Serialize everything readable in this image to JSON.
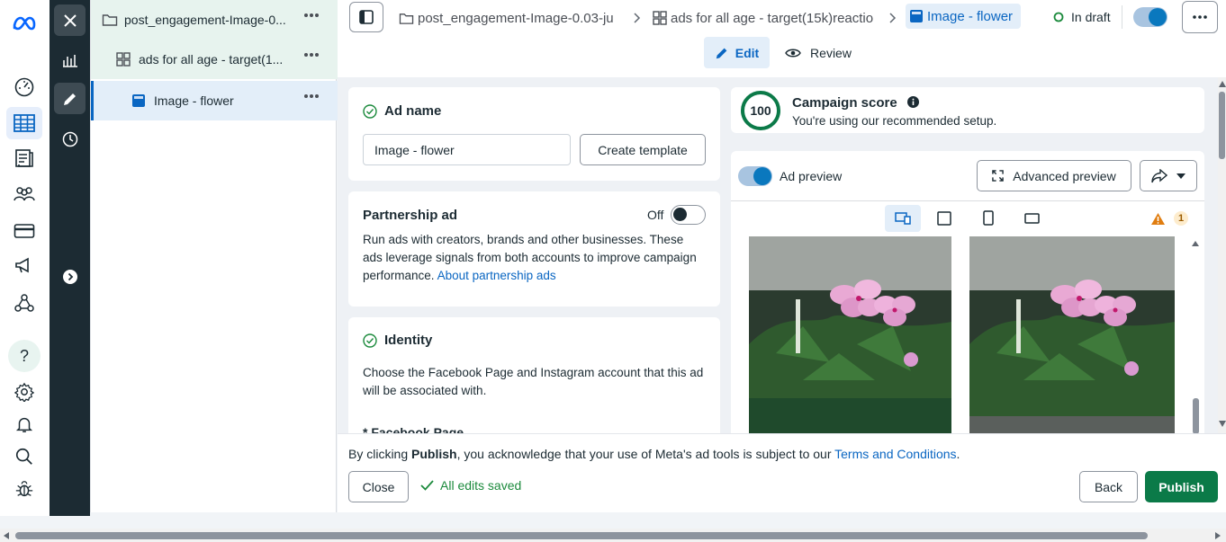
{
  "rail": {
    "icons": [
      "meta-logo-icon",
      "dashboard-icon",
      "ads-manager-table-icon",
      "pages-icon",
      "audiences-icon",
      "billing-icon",
      "campaign-icon",
      "events-icon",
      "help-icon",
      "settings-icon",
      "notifications-icon",
      "search-icon",
      "bug-icon"
    ],
    "help_glyph": "?"
  },
  "tree": {
    "items": [
      {
        "label": "post_engagement-Image-0...",
        "icon": "folder-icon"
      },
      {
        "label": "ads for all age - target(1...",
        "icon": "adset-grid-icon"
      },
      {
        "label": "Image - flower",
        "icon": "ad-square-icon"
      }
    ]
  },
  "topbar": {
    "crumbs": [
      "post_engagement-Image-0.03-ju",
      "ads for all age - target(15k)reactio",
      "Image - flower"
    ],
    "status": "In draft",
    "tabs": {
      "edit": "Edit",
      "review": "Review"
    }
  },
  "ad_name": {
    "title": "Ad name",
    "value": "Image - flower",
    "create_template": "Create template"
  },
  "partnership": {
    "title": "Partnership ad",
    "toggle_label": "Off",
    "description": "Run ads with creators, brands and other businesses. These ads leverage signals from both accounts to improve campaign performance.",
    "link": "About partnership ads"
  },
  "identity": {
    "title": "Identity",
    "description": "Choose the Facebook Page and Instagram account that this ad will be associated with.",
    "field_label": "* Facebook Page"
  },
  "campaign_score": {
    "score": "100",
    "score_value": 100,
    "title": "Campaign score",
    "subtitle": "You're using our recommended setup."
  },
  "preview": {
    "label": "Ad preview",
    "advanced": "Advanced preview",
    "warning_count": "1"
  },
  "footer": {
    "notice_pre": "By clicking ",
    "notice_bold": "Publish",
    "notice_mid": ", you acknowledge that your use of Meta's ad tools is subject to our ",
    "notice_link": "Terms and Conditions",
    "notice_end": ".",
    "close": "Close",
    "saved": "All edits saved",
    "back": "Back",
    "publish": "Publish"
  },
  "colors": {
    "accent": "#0a78be",
    "publish": "#0b7a48",
    "saved": "#1b8a3c",
    "warning": "#e07d10",
    "dark": "#1c2b33"
  }
}
